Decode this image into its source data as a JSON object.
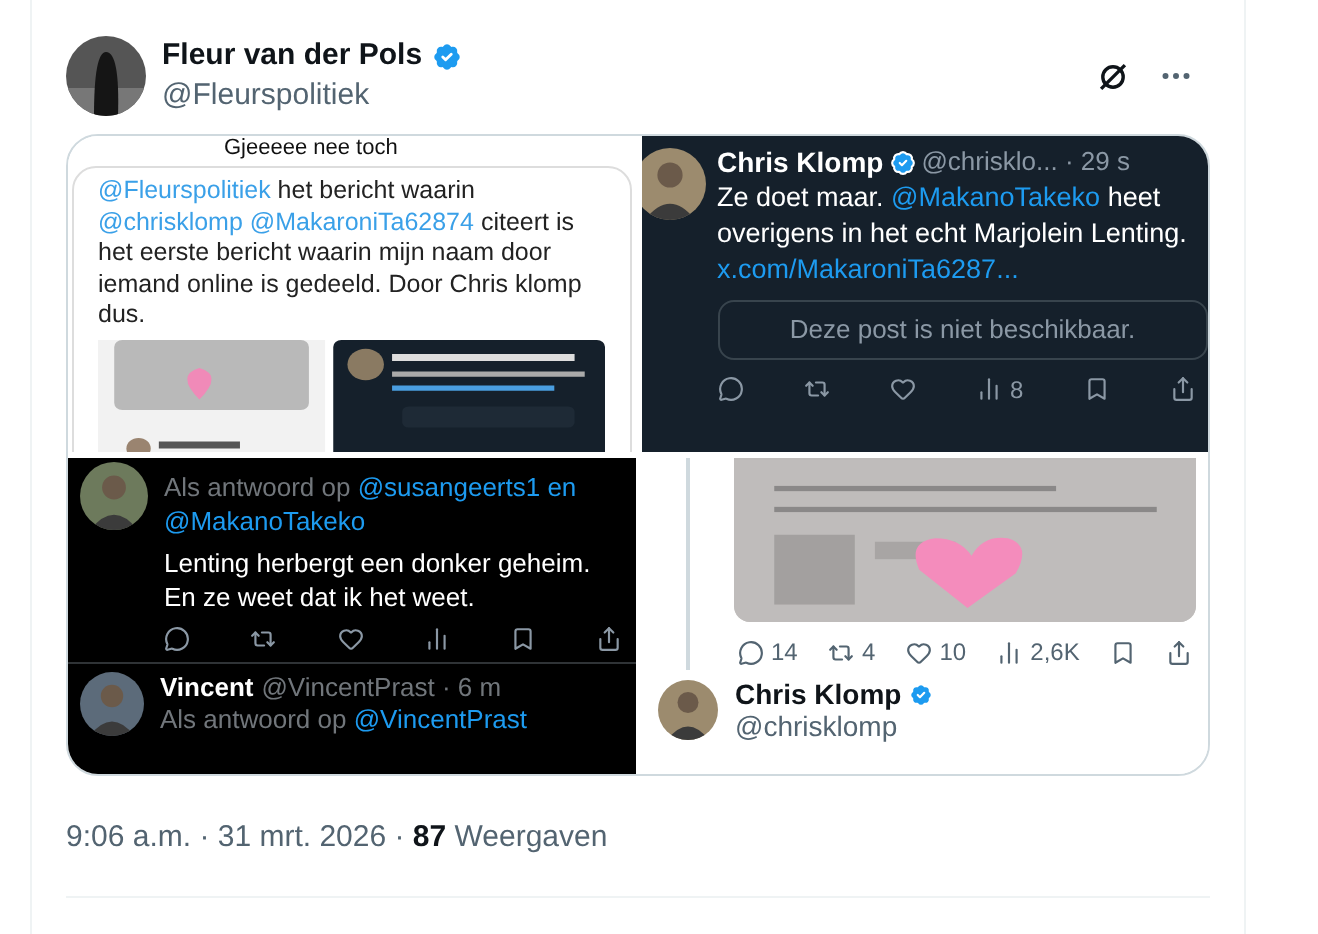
{
  "author": {
    "name": "Fleur van der Pols",
    "handle": "@Fleurspolitiek",
    "verified": true
  },
  "media": [
    {
      "kind": "post_light",
      "cut_line": "Gjeeeee nee toch",
      "segments": [
        {
          "kind": "mention",
          "text": "@Fleurspolitiek"
        },
        {
          "kind": "plain",
          "text": " het bericht waarin "
        },
        {
          "kind": "mention",
          "text": "@chrisklomp @MakaroniTa62874"
        },
        {
          "kind": "plain",
          "text": " citeert is het eerste bericht waarin mijn naam door iemand online is gedeeld. Door Chris klomp dus."
        }
      ]
    },
    {
      "kind": "post_dark",
      "name": "Chris Klomp",
      "meta": "@chrisklo... · 29 s",
      "segments": [
        {
          "kind": "plain",
          "text": "Ze doet maar. "
        },
        {
          "kind": "mention",
          "text": "@MakanoTakeko"
        },
        {
          "kind": "plain",
          "text": " heet overigens in het echt Marjolein Lenting. "
        },
        {
          "kind": "mention",
          "text": "x.com/MakaroniTa6287..."
        }
      ],
      "quote": "Deze post is niet beschikbaar.",
      "views": "8"
    },
    {
      "kind": "reply_black",
      "reply_label": "Als antwoord op ",
      "reply_to": "@susangeerts1 en @MakanoTakeko",
      "body": "Lenting herbergt een donker geheim. En ze weet dat ik het weet.",
      "next_name": "Vincent",
      "next_meta": "@VincentPrast · 6 m",
      "next_reply_label": "Als antwoord op ",
      "next_reply_to": "@VincentPrast"
    },
    {
      "kind": "document",
      "counts": [
        "14",
        "4",
        "10",
        "2,6K"
      ],
      "profile_name": "Chris Klomp",
      "profile_handle": "@chrisklomp"
    }
  ],
  "footer": {
    "time": "9:06 a.m. · 31 mrt. 2026 · ",
    "views_count": "87",
    "views_label": " Weergaven"
  }
}
